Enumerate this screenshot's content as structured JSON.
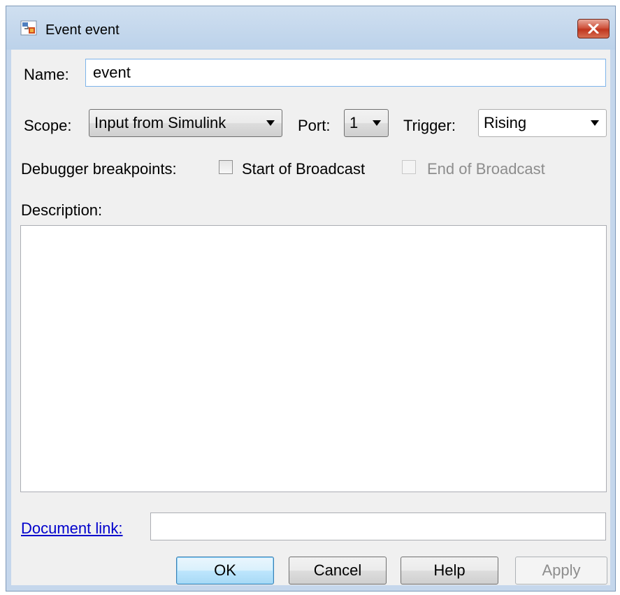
{
  "window": {
    "title": "Event event",
    "close_label": "×"
  },
  "name": {
    "label": "Name:",
    "value": "event"
  },
  "scope": {
    "label": "Scope:",
    "selected": "Input from Simulink"
  },
  "port": {
    "label": "Port:",
    "selected": "1"
  },
  "trigger": {
    "label": "Trigger:",
    "selected": "Rising"
  },
  "breakpoints": {
    "label": "Debugger breakpoints:",
    "start_label": "Start of Broadcast",
    "end_label": "End of Broadcast"
  },
  "description": {
    "label": "Description:",
    "value": ""
  },
  "document_link": {
    "label": "Document link:",
    "value": ""
  },
  "buttons": {
    "ok": "OK",
    "cancel": "Cancel",
    "help": "Help",
    "apply": "Apply"
  },
  "colors": {
    "frame": "#c5d7ec",
    "client": "#f0f0f0",
    "link": "#0000cc",
    "close": "#c0351e",
    "default_button": "#bee6fd"
  }
}
